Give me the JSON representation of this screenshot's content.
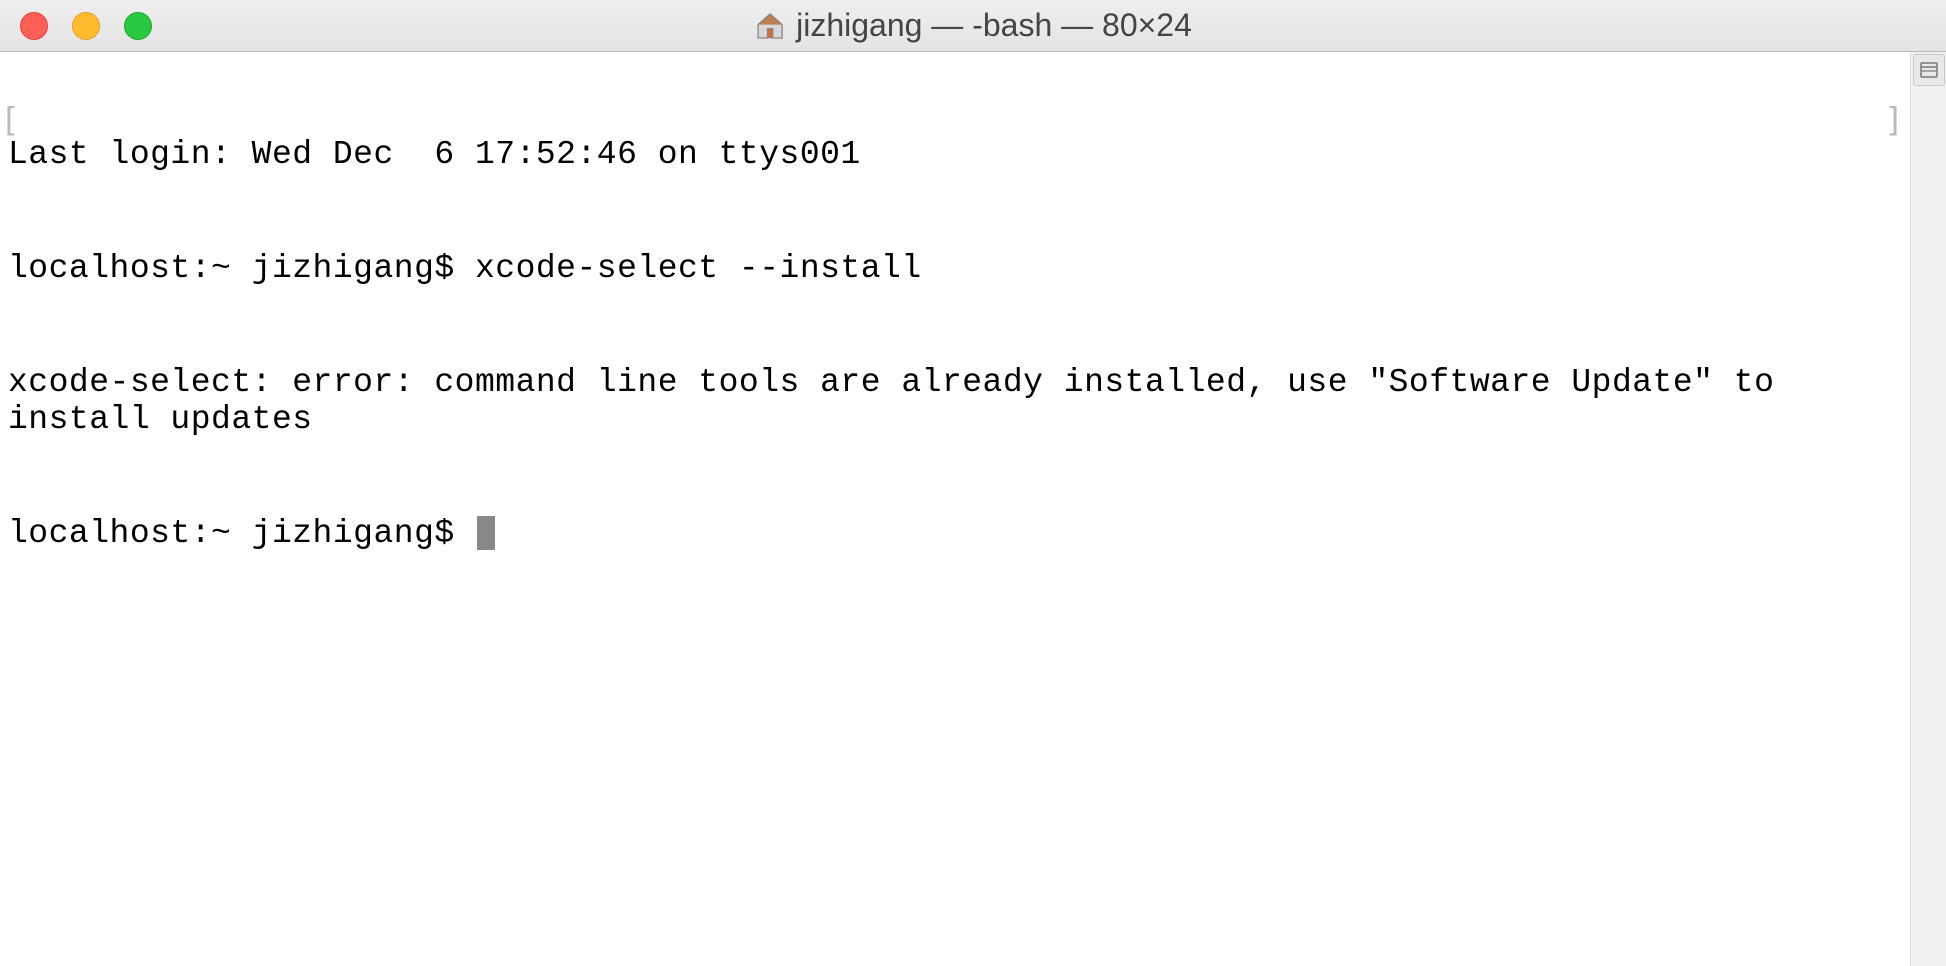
{
  "window": {
    "title": "jizhigang — -bash — 80×24"
  },
  "terminal": {
    "lines": [
      "Last login: Wed Dec  6 17:52:46 on ttys001",
      "localhost:~ jizhigang$ xcode-select --install",
      "xcode-select: error: command line tools are already installed, use \"Software Update\" to install updates",
      "localhost:~ jizhigang$ "
    ]
  }
}
